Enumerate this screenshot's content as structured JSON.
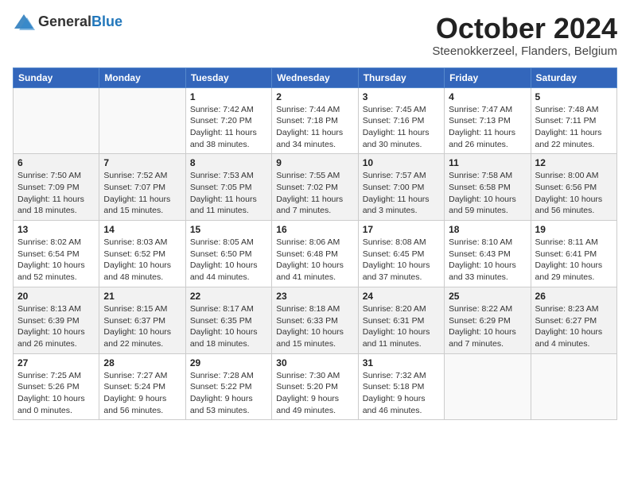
{
  "header": {
    "logo_line1": "General",
    "logo_line2": "Blue",
    "month": "October 2024",
    "location": "Steenokkerzeel, Flanders, Belgium"
  },
  "days_of_week": [
    "Sunday",
    "Monday",
    "Tuesday",
    "Wednesday",
    "Thursday",
    "Friday",
    "Saturday"
  ],
  "weeks": [
    [
      {
        "day": "",
        "info": ""
      },
      {
        "day": "",
        "info": ""
      },
      {
        "day": "1",
        "info": "Sunrise: 7:42 AM\nSunset: 7:20 PM\nDaylight: 11 hours and 38 minutes."
      },
      {
        "day": "2",
        "info": "Sunrise: 7:44 AM\nSunset: 7:18 PM\nDaylight: 11 hours and 34 minutes."
      },
      {
        "day": "3",
        "info": "Sunrise: 7:45 AM\nSunset: 7:16 PM\nDaylight: 11 hours and 30 minutes."
      },
      {
        "day": "4",
        "info": "Sunrise: 7:47 AM\nSunset: 7:13 PM\nDaylight: 11 hours and 26 minutes."
      },
      {
        "day": "5",
        "info": "Sunrise: 7:48 AM\nSunset: 7:11 PM\nDaylight: 11 hours and 22 minutes."
      }
    ],
    [
      {
        "day": "6",
        "info": "Sunrise: 7:50 AM\nSunset: 7:09 PM\nDaylight: 11 hours and 18 minutes."
      },
      {
        "day": "7",
        "info": "Sunrise: 7:52 AM\nSunset: 7:07 PM\nDaylight: 11 hours and 15 minutes."
      },
      {
        "day": "8",
        "info": "Sunrise: 7:53 AM\nSunset: 7:05 PM\nDaylight: 11 hours and 11 minutes."
      },
      {
        "day": "9",
        "info": "Sunrise: 7:55 AM\nSunset: 7:02 PM\nDaylight: 11 hours and 7 minutes."
      },
      {
        "day": "10",
        "info": "Sunrise: 7:57 AM\nSunset: 7:00 PM\nDaylight: 11 hours and 3 minutes."
      },
      {
        "day": "11",
        "info": "Sunrise: 7:58 AM\nSunset: 6:58 PM\nDaylight: 10 hours and 59 minutes."
      },
      {
        "day": "12",
        "info": "Sunrise: 8:00 AM\nSunset: 6:56 PM\nDaylight: 10 hours and 56 minutes."
      }
    ],
    [
      {
        "day": "13",
        "info": "Sunrise: 8:02 AM\nSunset: 6:54 PM\nDaylight: 10 hours and 52 minutes."
      },
      {
        "day": "14",
        "info": "Sunrise: 8:03 AM\nSunset: 6:52 PM\nDaylight: 10 hours and 48 minutes."
      },
      {
        "day": "15",
        "info": "Sunrise: 8:05 AM\nSunset: 6:50 PM\nDaylight: 10 hours and 44 minutes."
      },
      {
        "day": "16",
        "info": "Sunrise: 8:06 AM\nSunset: 6:48 PM\nDaylight: 10 hours and 41 minutes."
      },
      {
        "day": "17",
        "info": "Sunrise: 8:08 AM\nSunset: 6:45 PM\nDaylight: 10 hours and 37 minutes."
      },
      {
        "day": "18",
        "info": "Sunrise: 8:10 AM\nSunset: 6:43 PM\nDaylight: 10 hours and 33 minutes."
      },
      {
        "day": "19",
        "info": "Sunrise: 8:11 AM\nSunset: 6:41 PM\nDaylight: 10 hours and 29 minutes."
      }
    ],
    [
      {
        "day": "20",
        "info": "Sunrise: 8:13 AM\nSunset: 6:39 PM\nDaylight: 10 hours and 26 minutes."
      },
      {
        "day": "21",
        "info": "Sunrise: 8:15 AM\nSunset: 6:37 PM\nDaylight: 10 hours and 22 minutes."
      },
      {
        "day": "22",
        "info": "Sunrise: 8:17 AM\nSunset: 6:35 PM\nDaylight: 10 hours and 18 minutes."
      },
      {
        "day": "23",
        "info": "Sunrise: 8:18 AM\nSunset: 6:33 PM\nDaylight: 10 hours and 15 minutes."
      },
      {
        "day": "24",
        "info": "Sunrise: 8:20 AM\nSunset: 6:31 PM\nDaylight: 10 hours and 11 minutes."
      },
      {
        "day": "25",
        "info": "Sunrise: 8:22 AM\nSunset: 6:29 PM\nDaylight: 10 hours and 7 minutes."
      },
      {
        "day": "26",
        "info": "Sunrise: 8:23 AM\nSunset: 6:27 PM\nDaylight: 10 hours and 4 minutes."
      }
    ],
    [
      {
        "day": "27",
        "info": "Sunrise: 7:25 AM\nSunset: 5:26 PM\nDaylight: 10 hours and 0 minutes."
      },
      {
        "day": "28",
        "info": "Sunrise: 7:27 AM\nSunset: 5:24 PM\nDaylight: 9 hours and 56 minutes."
      },
      {
        "day": "29",
        "info": "Sunrise: 7:28 AM\nSunset: 5:22 PM\nDaylight: 9 hours and 53 minutes."
      },
      {
        "day": "30",
        "info": "Sunrise: 7:30 AM\nSunset: 5:20 PM\nDaylight: 9 hours and 49 minutes."
      },
      {
        "day": "31",
        "info": "Sunrise: 7:32 AM\nSunset: 5:18 PM\nDaylight: 9 hours and 46 minutes."
      },
      {
        "day": "",
        "info": ""
      },
      {
        "day": "",
        "info": ""
      }
    ]
  ]
}
